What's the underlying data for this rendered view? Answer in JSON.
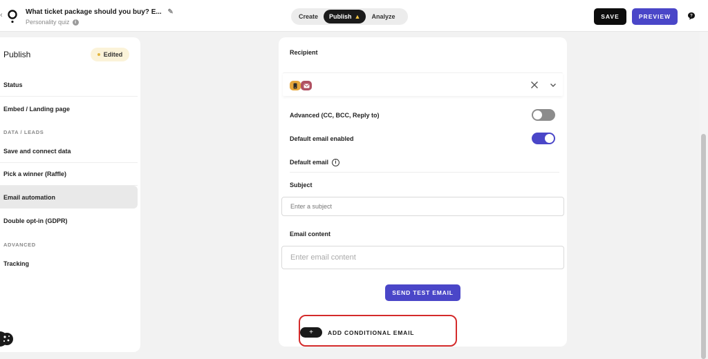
{
  "header": {
    "back_glyph": "‹",
    "quiz_title": "What ticket package should you buy? E...",
    "quiz_type": "Personality quiz",
    "info_glyph": "i",
    "tabs": [
      {
        "label": "Create"
      },
      {
        "label": "Publish",
        "warning": "▲"
      },
      {
        "label": "Analyze"
      }
    ],
    "save_label": "SAVE",
    "preview_label": "PREVIEW",
    "icons": [
      "logo",
      "pencil-icon",
      "info-icon",
      "warning-icon",
      "help-chat-icon"
    ]
  },
  "sidebar": {
    "title": "Publish",
    "badge": "Edited",
    "items": [
      {
        "label": "Status"
      },
      {
        "label": "Embed / Landing page"
      },
      {
        "label": "Save and connect data"
      },
      {
        "label": "Pick a winner (Raffle)"
      },
      {
        "label": "Email automation",
        "active": true
      },
      {
        "label": "Double opt-in (GDPR)"
      },
      {
        "label": "Tracking"
      }
    ],
    "sections": [
      "DATA / LEADS",
      "ADVANCED"
    ]
  },
  "email": {
    "recipient_label": "Recipient",
    "advanced_label": "Advanced (CC, BCC, Reply to)",
    "advanced_enabled": false,
    "default_enabled_label": "Default email enabled",
    "default_enabled": true,
    "default_email_label": "Default email",
    "info_glyph": "i",
    "subject_label": "Subject",
    "subject_placeholder": "Enter a subject",
    "subject_value": "",
    "content_label": "Email content",
    "content_placeholder": "Enter email content",
    "content_value": "",
    "send_test_label": "SEND TEST EMAIL",
    "conditional_plus": "+",
    "conditional_label": "ADD CONDITIONAL EMAIL"
  },
  "colors": {
    "accent": "#4a46c8",
    "dark": "#0d0d0d",
    "highlight_outline": "#d42a2a",
    "chip_yellow": "#e6a63b",
    "chip_red": "#b05062"
  }
}
